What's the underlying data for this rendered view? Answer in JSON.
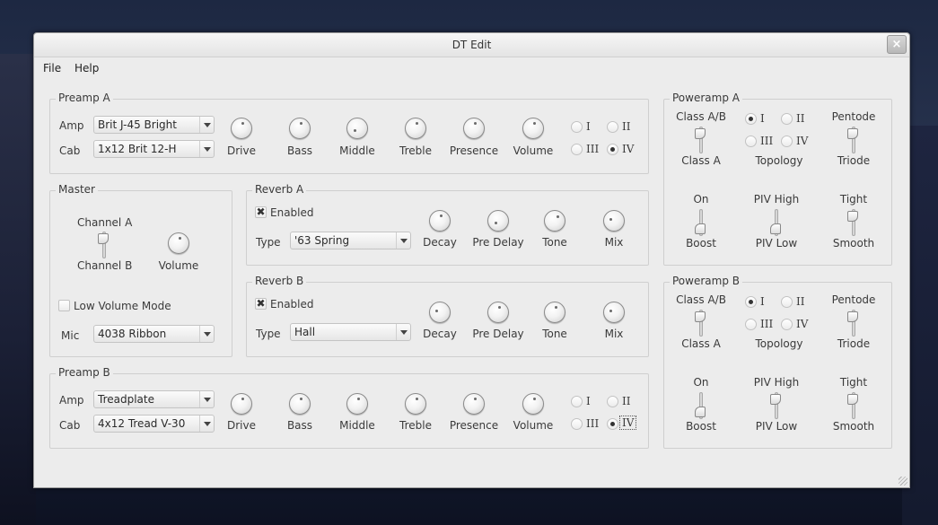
{
  "window": {
    "title": "DT Edit",
    "close_glyph": "×"
  },
  "menu": {
    "file": "File",
    "help": "Help"
  },
  "preamp_a": {
    "title": "Preamp A",
    "amp_label": "Amp",
    "amp_value": "Brit J-45 Bright",
    "cab_label": "Cab",
    "cab_value": "1x12 Brit 12-H",
    "knobs": [
      "Drive",
      "Bass",
      "Middle",
      "Treble",
      "Presence",
      "Volume"
    ],
    "voicing": {
      "i": "I",
      "ii": "II",
      "iii": "III",
      "iv": "IV",
      "selected": "IV"
    }
  },
  "master": {
    "title": "Master",
    "channel_a": "Channel A",
    "channel_b": "Channel B",
    "volume": "Volume",
    "low_volume_mode": "Low Volume Mode",
    "low_volume_checked": false,
    "mic_label": "Mic",
    "mic_value": "4038 Ribbon"
  },
  "reverb_a": {
    "title": "Reverb A",
    "enabled_label": "Enabled",
    "enabled": true,
    "type_label": "Type",
    "type_value": "'63 Spring",
    "knobs": [
      "Decay",
      "Pre Delay",
      "Tone",
      "Mix"
    ]
  },
  "reverb_b": {
    "title": "Reverb B",
    "enabled_label": "Enabled",
    "enabled": true,
    "type_label": "Type",
    "type_value": "Hall",
    "knobs": [
      "Decay",
      "Pre Delay",
      "Tone",
      "Mix"
    ]
  },
  "preamp_b": {
    "title": "Preamp B",
    "amp_label": "Amp",
    "amp_value": "Treadplate",
    "cab_label": "Cab",
    "cab_value": "4x12 Tread V-30",
    "knobs": [
      "Drive",
      "Bass",
      "Middle",
      "Treble",
      "Presence",
      "Volume"
    ],
    "voicing": {
      "i": "I",
      "ii": "II",
      "iii": "III",
      "iv": "IV",
      "selected": "IV"
    }
  },
  "poweramp_a": {
    "title": "Poweramp A",
    "class_top": "Class A/B",
    "class_bottom": "Class A",
    "topology": {
      "i": "I",
      "ii": "II",
      "iii": "III",
      "iv": "IV",
      "label": "Topology",
      "selected": "I"
    },
    "pentode": "Pentode",
    "triode": "Triode",
    "on": "On",
    "boost": "Boost",
    "piv_high": "PIV High",
    "piv_low": "PIV Low",
    "tight": "Tight",
    "smooth": "Smooth"
  },
  "poweramp_b": {
    "title": "Poweramp B",
    "class_top": "Class A/B",
    "class_bottom": "Class A",
    "topology": {
      "i": "I",
      "ii": "II",
      "iii": "III",
      "iv": "IV",
      "label": "Topology",
      "selected": "I"
    },
    "pentode": "Pentode",
    "triode": "Triode",
    "on": "On",
    "boost": "Boost",
    "piv_high": "PIV High",
    "piv_low": "PIV Low",
    "tight": "Tight",
    "smooth": "Smooth"
  }
}
